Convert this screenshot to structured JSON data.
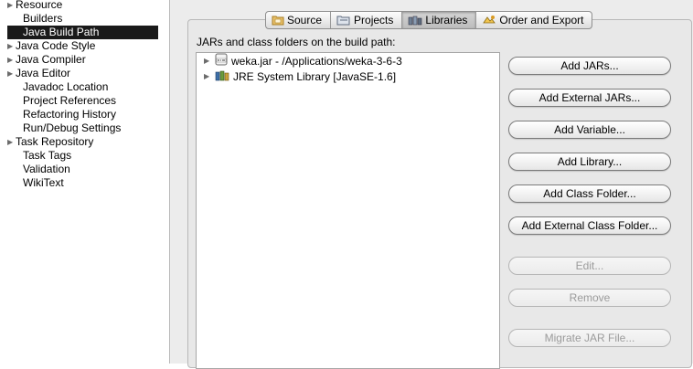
{
  "nav": {
    "items": [
      {
        "label": "Resource",
        "expandable": true,
        "selected": false
      },
      {
        "label": "Builders",
        "expandable": false,
        "selected": false
      },
      {
        "label": "Java Build Path",
        "expandable": false,
        "selected": true
      },
      {
        "label": "Java Code Style",
        "expandable": true,
        "selected": false
      },
      {
        "label": "Java Compiler",
        "expandable": true,
        "selected": false
      },
      {
        "label": "Java Editor",
        "expandable": true,
        "selected": false
      },
      {
        "label": "Javadoc Location",
        "expandable": false,
        "selected": false
      },
      {
        "label": "Project References",
        "expandable": false,
        "selected": false
      },
      {
        "label": "Refactoring History",
        "expandable": false,
        "selected": false
      },
      {
        "label": "Run/Debug Settings",
        "expandable": false,
        "selected": false
      },
      {
        "label": "Task Repository",
        "expandable": true,
        "selected": false
      },
      {
        "label": "Task Tags",
        "expandable": false,
        "selected": false
      },
      {
        "label": "Validation",
        "expandable": false,
        "selected": false
      },
      {
        "label": "WikiText",
        "expandable": false,
        "selected": false
      }
    ]
  },
  "tabs": [
    {
      "label": "Source",
      "icon": "source-folder-icon",
      "active": false
    },
    {
      "label": "Projects",
      "icon": "projects-icon",
      "active": false
    },
    {
      "label": "Libraries",
      "icon": "libraries-icon",
      "active": true
    },
    {
      "label": "Order and Export",
      "icon": "order-export-icon",
      "active": false
    }
  ],
  "buildpath_label": "JARs and class folders on the build path:",
  "tree": [
    {
      "label": "weka.jar - /Applications/weka-3-6-3",
      "icon": "jar-icon"
    },
    {
      "label": "JRE System Library [JavaSE-1.6]",
      "icon": "jre-library-icon"
    }
  ],
  "buttons": [
    {
      "label": "Add JARs...",
      "enabled": true
    },
    {
      "label": "Add External JARs...",
      "enabled": true
    },
    {
      "label": "Add Variable...",
      "enabled": true
    },
    {
      "label": "Add Library...",
      "enabled": true
    },
    {
      "label": "Add Class Folder...",
      "enabled": true
    },
    {
      "label": "Add External Class Folder...",
      "enabled": true
    },
    {
      "label": "Edit...",
      "enabled": false
    },
    {
      "label": "Remove",
      "enabled": false
    },
    {
      "label": "Migrate JAR File...",
      "enabled": false
    }
  ],
  "colors": {
    "selected_bg": "#1a1a1a",
    "panel_bg": "#ececec",
    "disabled_text": "#9b9b9b"
  }
}
